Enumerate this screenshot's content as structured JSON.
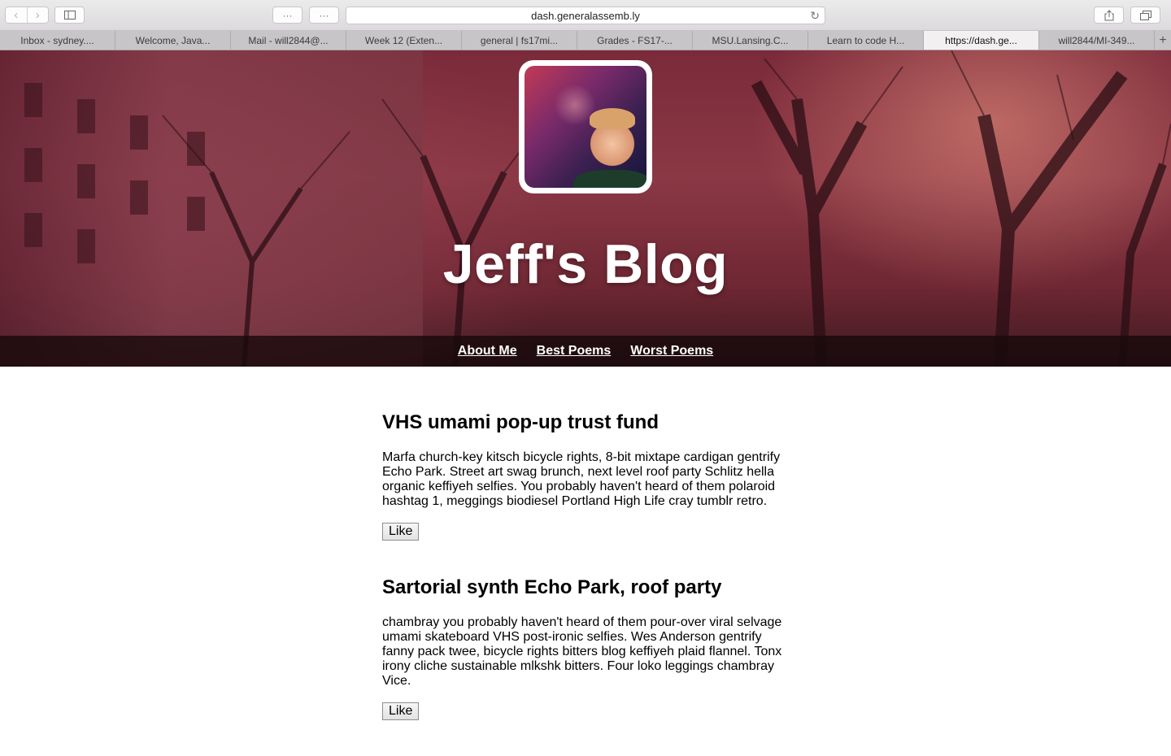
{
  "browser": {
    "address": "dash.generalassemb.ly",
    "toolbar_dots_1": "···",
    "toolbar_dots_2": "···",
    "tabs": [
      {
        "label": "Inbox - sydney...."
      },
      {
        "label": "Welcome, Java..."
      },
      {
        "label": "Mail - will2844@..."
      },
      {
        "label": "Week 12 (Exten..."
      },
      {
        "label": "general | fs17mi..."
      },
      {
        "label": "Grades - FS17-..."
      },
      {
        "label": "MSU.Lansing.C..."
      },
      {
        "label": "Learn to code H..."
      },
      {
        "label": "https://dash.ge..."
      },
      {
        "label": "will2844/MI-349..."
      }
    ]
  },
  "header": {
    "title": "Jeff's Blog",
    "nav": [
      "About Me",
      "Best Poems",
      "Worst Poems"
    ]
  },
  "posts": [
    {
      "title": "VHS umami pop-up trust fund",
      "body": "Marfa church-key kitsch bicycle rights, 8-bit mixtape cardigan gentrify Echo Park. Street art swag brunch, next level roof party Schlitz hella organic keffiyeh selfies. You probably haven't heard of them polaroid hashtag 1, meggings biodiesel Portland High Life cray tumblr retro.",
      "like_label": "Like"
    },
    {
      "title": "Sartorial synth Echo Park, roof party",
      "body": "chambray you probably haven't heard of them pour-over viral selvage umami skateboard VHS post-ironic selfies. Wes Anderson gentrify fanny pack twee, bicycle rights bitters blog keffiyeh plaid flannel. Tonx irony cliche sustainable mlkshk bitters. Four loko leggings chambray Vice.",
      "like_label": "Like"
    }
  ]
}
